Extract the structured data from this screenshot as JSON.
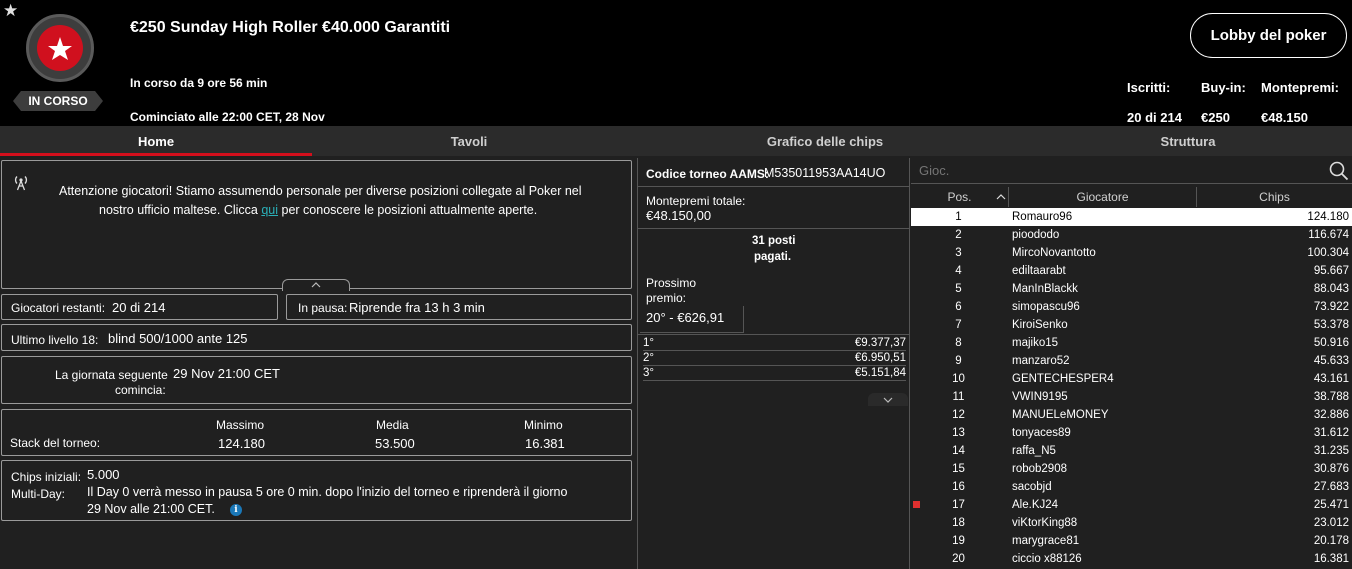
{
  "header": {
    "status_badge": "IN CORSO",
    "title": "€250 Sunday High Roller €40.000 Garantiti",
    "running_for": "In corso da 9 ore 56 min",
    "started_at": "Cominciato alle 22:00 CET, 28 Nov",
    "lobby_button": "Lobby del poker",
    "stats": [
      {
        "label": "Iscritti:",
        "value": "20 di 214"
      },
      {
        "label": "Buy-in:",
        "value": "€250"
      },
      {
        "label": "Montepremi:",
        "value": "€48.150"
      }
    ]
  },
  "tabs": [
    "Home",
    "Tavoli",
    "Grafico delle chips",
    "Struttura"
  ],
  "announcement": {
    "line1": "Attenzione giocatori! Stiamo assumendo personale per diverse posizioni collegate al Poker nel",
    "line2_pre": "nostro ufficio maltese. Clicca ",
    "link": "qui",
    "line2_post": " per conoscere le posizioni attualmente aperte."
  },
  "info": {
    "remaining_label": "Giocatori restanti:",
    "remaining_value": "20 di 214",
    "pause_label": "In pausa:",
    "pause_value": "Riprende fra 13 h 3 min",
    "level_label": "Ultimo livello 18:",
    "level_value": "blind 500/1000 ante 125",
    "next_day_label1": "La giornata seguente",
    "next_day_label2": "comincia:",
    "next_day_value": "29 Nov 21:00 CET",
    "stack_label": "Stack del torneo:",
    "stack": [
      {
        "label": "Massimo",
        "value": "124.180"
      },
      {
        "label": "Media",
        "value": "53.500"
      },
      {
        "label": "Minimo",
        "value": "16.381"
      }
    ],
    "initial_chips_label": "Chips iniziali:",
    "initial_chips_value": "5.000",
    "multiday_label": "Multi-Day:",
    "multiday_line1": "Il Day 0 verrà messo in pausa 5 ore 0 min. dopo l'inizio del torneo e riprenderà il giorno",
    "multiday_line2": "29 Nov alle 21:00 CET."
  },
  "prize_panel": {
    "aams_label": "Codice torneo AAMS:",
    "aams_value": "M535011953AA14UO",
    "total_label": "Montepremi totale:",
    "total_value": "€48.150,00",
    "paid_line1": "31 posti",
    "paid_line2": "pagati.",
    "next_label1": "Prossimo",
    "next_label2": "premio:",
    "next_value": "20° - €626,91",
    "prizes": [
      {
        "place": "1°",
        "amount": "€9.377,37"
      },
      {
        "place": "2°",
        "amount": "€6.950,51"
      },
      {
        "place": "3°",
        "amount": "€5.151,84"
      }
    ]
  },
  "players": {
    "search_placeholder": "Gioc.",
    "columns": [
      "Pos.",
      "Giocatore",
      "Chips"
    ],
    "rows": [
      {
        "pos": "1",
        "name": "Romauro96",
        "chips": "124.180"
      },
      {
        "pos": "2",
        "name": "pioododo",
        "chips": "116.674"
      },
      {
        "pos": "3",
        "name": "MircoNovantotto",
        "chips": "100.304"
      },
      {
        "pos": "4",
        "name": "ediltaarabt",
        "chips": "95.667"
      },
      {
        "pos": "5",
        "name": "ManInBlackk",
        "chips": "88.043"
      },
      {
        "pos": "6",
        "name": "simopascu96",
        "chips": "73.922"
      },
      {
        "pos": "7",
        "name": "KiroiSenko",
        "chips": "53.378"
      },
      {
        "pos": "8",
        "name": "majiko15",
        "chips": "50.916"
      },
      {
        "pos": "9",
        "name": "manzaro52",
        "chips": "45.633"
      },
      {
        "pos": "10",
        "name": "GENTECHESPER4",
        "chips": "43.161"
      },
      {
        "pos": "11",
        "name": "VWIN9195",
        "chips": "38.788"
      },
      {
        "pos": "12",
        "name": "MANUELeMONEY",
        "chips": "32.886"
      },
      {
        "pos": "13",
        "name": "tonyaces89",
        "chips": "31.612"
      },
      {
        "pos": "14",
        "name": "raffa_N5",
        "chips": "31.235"
      },
      {
        "pos": "15",
        "name": "robob2908",
        "chips": "30.876"
      },
      {
        "pos": "16",
        "name": "sacobjd",
        "chips": "27.683"
      },
      {
        "pos": "17",
        "name": "Ale.KJ24",
        "chips": "25.471"
      },
      {
        "pos": "18",
        "name": "viKtorKing88",
        "chips": "23.012"
      },
      {
        "pos": "19",
        "name": "marygrace81",
        "chips": "20.178"
      },
      {
        "pos": "20",
        "name": "ciccio x88126",
        "chips": "16.381"
      }
    ]
  },
  "colors": {
    "accent": "#d40f1c",
    "link": "#2bb0b8",
    "info_icon": "#1a78b8"
  }
}
